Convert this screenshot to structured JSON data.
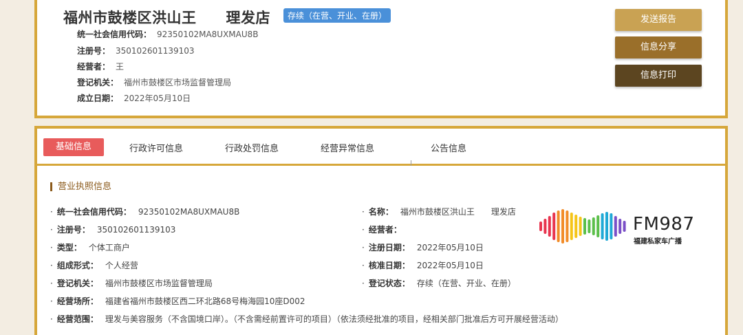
{
  "header": {
    "company_name": "福州市鼓楼区洪山王  理发店",
    "status": "存续（在营、开业、在册）",
    "fields": [
      {
        "label": "统一社会信用代码：",
        "value": "92350102MA8UXMAU8B"
      },
      {
        "label": "注册号：",
        "value": "350102601139103"
      },
      {
        "label": "经营者：",
        "value": "王"
      },
      {
        "label": "登记机关：",
        "value": "福州市鼓楼区市场监督管理局"
      },
      {
        "label": "成立日期：",
        "value": "2022年05月10日"
      }
    ],
    "buttons": {
      "report": "发送报告",
      "share": "信息分享",
      "print": "信息打印"
    }
  },
  "tabs": [
    "基础信息",
    "行政许可信息",
    "行政处罚信息",
    "经营异常信息",
    "公告信息"
  ],
  "section": {
    "title": "营业执照信息",
    "left": [
      {
        "label": "统一社会信用代码：",
        "value": "92350102MA8UXMAU8B"
      },
      {
        "label": "注册号：",
        "value": "350102601139103"
      },
      {
        "label": "类型：",
        "value": "个体工商户"
      },
      {
        "label": "组成形式：",
        "value": "个人经营"
      },
      {
        "label": "登记机关：",
        "value": "福州市鼓楼区市场监督管理局"
      },
      {
        "label": "经营场所：",
        "value": "福建省福州市鼓楼区西二环北路68号梅海园10座D002"
      },
      {
        "label": "经营范围：",
        "value": "理发与美容服务（不含国境口岸）。（不含需经前置许可的项目）（依法须经批准的项目，经相关部门批准后方可开展经营活动）"
      }
    ],
    "right": [
      {
        "label": "名称：",
        "value": "福州市鼓楼区洪山王  理发店"
      },
      {
        "label": "经营者：",
        "value": ""
      },
      {
        "label": "注册日期：",
        "value": "2022年05月10日"
      },
      {
        "label": "核准日期：",
        "value": "2022年05月10日"
      },
      {
        "label": "登记状态：",
        "value": "存续（在营、开业、在册）"
      }
    ]
  },
  "watermark": {
    "brand": "FM987",
    "subtitle": "福建私家车广播",
    "bar_colors": [
      "#e8344e",
      "#f28c28",
      "#f5c518",
      "#5bbf4a",
      "#1fa9d6",
      "#7a4fc7"
    ]
  }
}
